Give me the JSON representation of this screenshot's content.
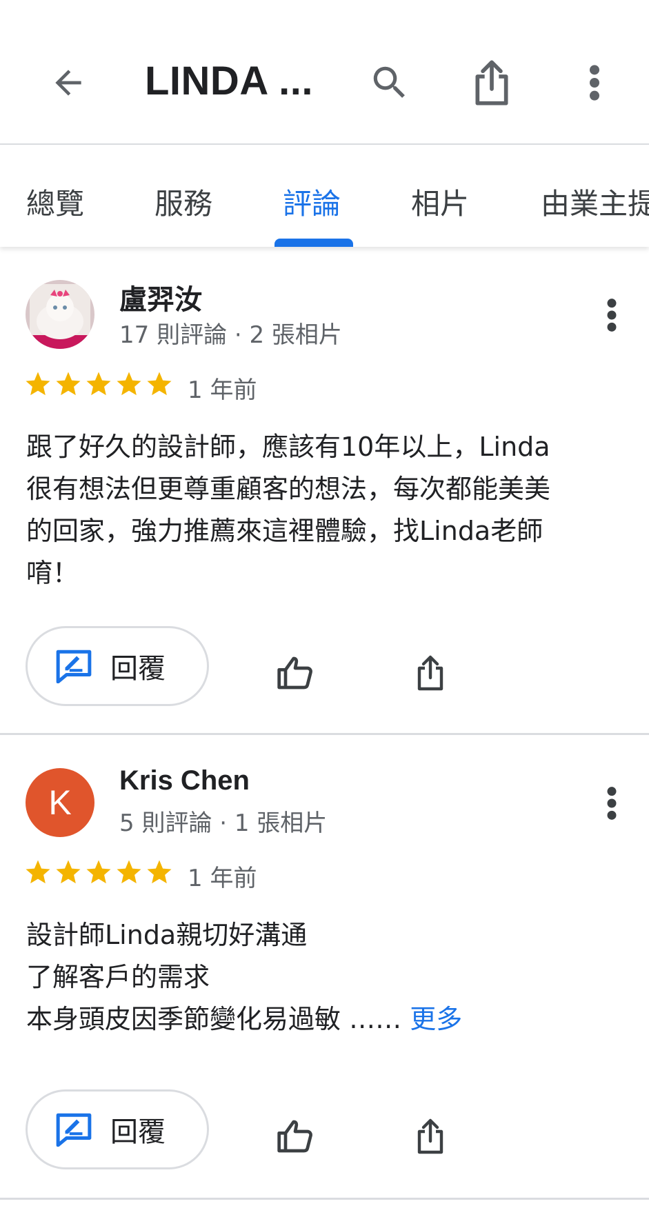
{
  "header": {
    "title": "LINDA ...",
    "back_icon": "arrow-back-icon",
    "search_icon": "search-icon",
    "share_icon": "share-icon",
    "more_icon": "more-vert-icon"
  },
  "tabs": [
    {
      "label": "總覽",
      "active": false
    },
    {
      "label": "服務",
      "active": false
    },
    {
      "label": "評論",
      "active": true
    },
    {
      "label": "相片",
      "active": false
    },
    {
      "label": "由業主提",
      "active": false
    }
  ],
  "colors": {
    "accent": "#1a73e8",
    "star": "#f4b400",
    "avatar_k": "#e0552c"
  },
  "reviews": [
    {
      "author": "盧羿汝",
      "meta": "17 則評論 · 2 張相片",
      "rating": 5,
      "time": "1 年前",
      "text": "跟了好久的設計師，應該有10年以上，Linda\n很有想法但更尊重顧客的想法，每次都能美美\n的回家，強力推薦來這裡體驗，找Linda老師\n唷！",
      "reply_label": "回覆"
    },
    {
      "author": "Kris Chen",
      "avatar_letter": "K",
      "meta": "5 則評論 · 1 張相片",
      "rating": 5,
      "time": "1 年前",
      "text": "設計師Linda親切好溝通\n了解客戶的需求\n本身頭皮因季節變化易過敏 ……",
      "more_label": "更多",
      "reply_label": "回覆"
    }
  ]
}
